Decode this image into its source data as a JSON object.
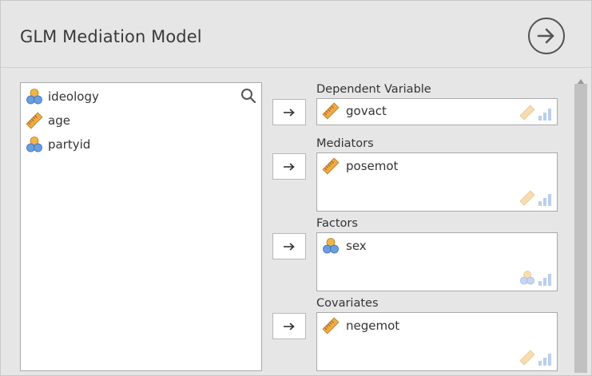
{
  "header": {
    "title": "GLM Mediation Model",
    "run_icon": "arrow-circle-right-icon"
  },
  "source_list": {
    "items": [
      {
        "label": "ideology",
        "icon": "nominal-variable-icon"
      },
      {
        "label": "age",
        "icon": "continuous-variable-icon"
      },
      {
        "label": "partyid",
        "icon": "nominal-variable-icon"
      }
    ]
  },
  "targets": {
    "dependent": {
      "label": "Dependent Variable",
      "value": "govact"
    },
    "mediators": {
      "label": "Mediators",
      "value": "posemot"
    },
    "factors": {
      "label": "Factors",
      "value": "sex"
    },
    "covariates": {
      "label": "Covariates",
      "value": "negemot"
    }
  },
  "colors": {
    "continuous": "#e8a33c",
    "nominal_blue": "#5b8fd6",
    "nominal_orange": "#f0b44a",
    "hint_faded": "#f3d7a8",
    "hint_bars": "#b9cfee"
  }
}
